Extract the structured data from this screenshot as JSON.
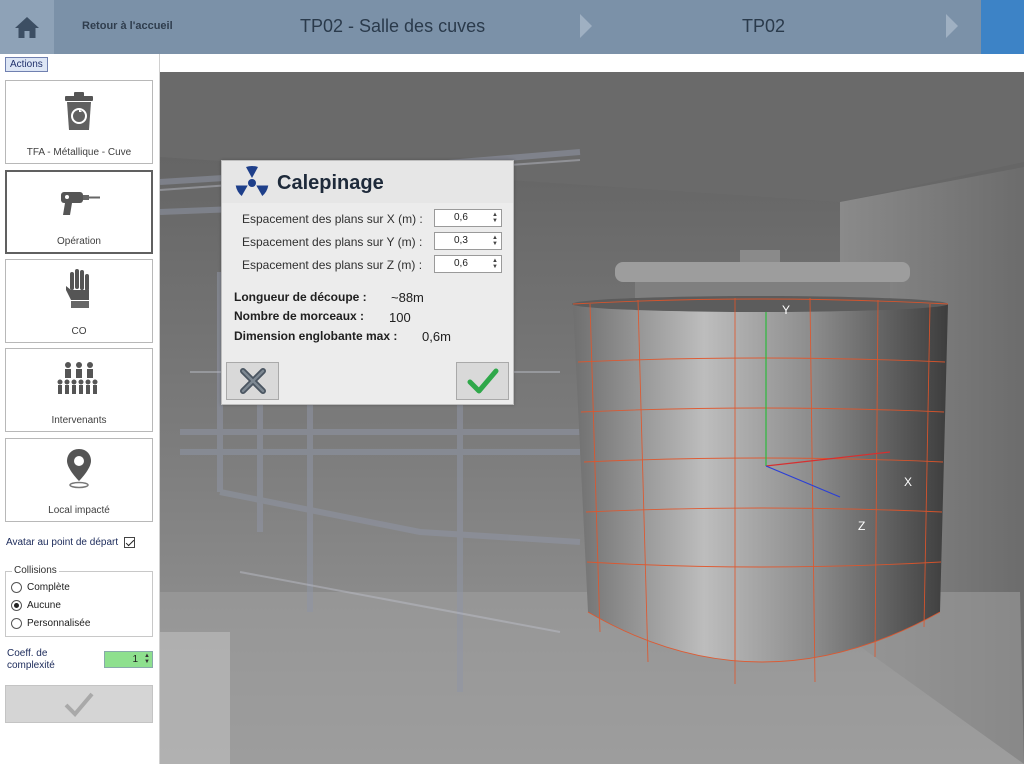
{
  "header": {
    "home_label": "Retour à l'accueil",
    "breadcrumb_1": "TP02 - Salle des cuves",
    "breadcrumb_2": "TP02"
  },
  "sidebar": {
    "actions_tab": "Actions",
    "tiles": [
      {
        "label": "TFA - Métallique - Cuve",
        "icon": "recycle-bin-icon"
      },
      {
        "label": "Opération",
        "icon": "drill-icon"
      },
      {
        "label": "CO",
        "icon": "glove-icon"
      },
      {
        "label": "Intervenants",
        "icon": "people-icon"
      },
      {
        "label": "Local impacté",
        "icon": "location-pin-icon"
      }
    ],
    "avatar_start_label": "Avatar au point de départ",
    "avatar_start_checked": true,
    "collisions": {
      "legend": "Collisions",
      "options": [
        "Complète",
        "Aucune",
        "Personnalisée"
      ],
      "selected": "Aucune"
    },
    "coeff_label": "Coeff. de complexité",
    "coeff_value": "1",
    "validate_icon": "check-icon"
  },
  "dialog": {
    "title": "Calepinage",
    "icon": "radiation-icon",
    "params": [
      {
        "label": "Espacement des plans sur X (m) :",
        "value": "0,6"
      },
      {
        "label": "Espacement des plans sur Y (m) :",
        "value": "0,3"
      },
      {
        "label": "Espacement des plans sur Z (m) :",
        "value": "0,6"
      }
    ],
    "info": [
      {
        "label": "Longueur de découpe :",
        "value": "~88m"
      },
      {
        "label": "Nombre de morceaux :",
        "value": "100"
      },
      {
        "label": "Dimension englobante max :",
        "value": "0,6m"
      }
    ]
  },
  "viewport": {
    "axis_x": "X",
    "axis_y": "Y",
    "axis_z": "Z"
  },
  "colors": {
    "topbar": "#7b91a8",
    "accent_blue": "#3d83c6",
    "ok_green": "#2fa84a",
    "mesh_orange": "#e2552a"
  }
}
